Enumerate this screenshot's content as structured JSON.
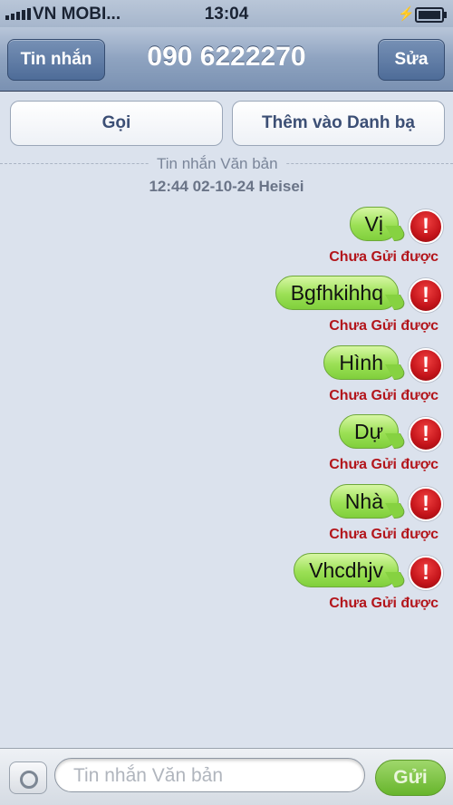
{
  "status_bar": {
    "carrier": "VN MOBI...",
    "time": "13:04"
  },
  "nav": {
    "back_label": "Tin nhắn",
    "title": "090 6222270",
    "edit_label": "Sửa"
  },
  "actions": {
    "call_label": "Gọi",
    "add_contact_label": "Thêm vào Danh bạ"
  },
  "thread": {
    "type_label": "Tin nhắn Văn bản",
    "timestamp": "12:44 02-10-24 Heisei"
  },
  "messages": [
    {
      "text": "Vị",
      "status": "Chưa Gửi được",
      "error_icon": "!"
    },
    {
      "text": "Bgfhkihhq",
      "status": "Chưa Gửi được",
      "error_icon": "!"
    },
    {
      "text": "Hình",
      "status": "Chưa Gửi được",
      "error_icon": "!"
    },
    {
      "text": "Dự",
      "status": "Chưa Gửi được",
      "error_icon": "!"
    },
    {
      "text": "Nhà",
      "status": "Chưa Gửi được",
      "error_icon": "!"
    },
    {
      "text": "Vhcdhjv",
      "status": "Chưa Gửi được",
      "error_icon": "!"
    }
  ],
  "composer": {
    "placeholder": "Tin nhắn Văn bản",
    "send_label": "Gửi"
  },
  "colors": {
    "bubble_green": "#9be055",
    "error_red": "#c4141a",
    "nav_blue": "#7a91b2"
  }
}
